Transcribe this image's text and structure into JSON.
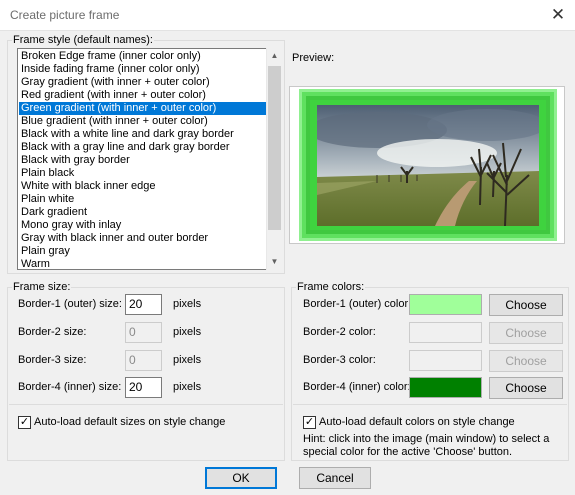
{
  "window": {
    "title": "Create picture frame",
    "close_glyph": "✕"
  },
  "frame_style": {
    "legend": "Frame style (default names):",
    "items": [
      "Broken Edge frame (inner color only)",
      "Inside fading frame (inner color only)",
      "Gray gradient (with inner + outer color)",
      "Red gradient (with inner + outer color)",
      "Green gradient (with inner + outer color)",
      "Blue gradient (with inner + outer color)",
      "Black with a white line and dark gray border",
      "Black with a gray line and dark gray border",
      "Black with gray border",
      "Plain black",
      "White with black inner edge",
      "Plain white",
      "Dark gradient",
      "Mono gray with inlay",
      "Gray with black inner and outer border",
      "Plain gray",
      "Warm"
    ],
    "selected": "Green gradient (with inner + outer color)"
  },
  "preview": {
    "label": "Preview:"
  },
  "frame_size": {
    "legend": "Frame size:",
    "rows": [
      {
        "label": "Border-1 (outer) size:",
        "value": "20",
        "unit": "pixels",
        "enabled": true
      },
      {
        "label": "Border-2 size:",
        "value": "0",
        "unit": "pixels",
        "enabled": false
      },
      {
        "label": "Border-3 size:",
        "value": "0",
        "unit": "pixels",
        "enabled": false
      },
      {
        "label": "Border-4 (inner) size:",
        "value": "20",
        "unit": "pixels",
        "enabled": true
      }
    ],
    "autoload_label": "Auto-load default sizes on style change",
    "autoload_checked": true
  },
  "frame_colors": {
    "legend": "Frame colors:",
    "rows": [
      {
        "label": "Border-1 (outer) color:",
        "color": "#a0ff9a",
        "button": "Choose",
        "enabled": true
      },
      {
        "label": "Border-2 color:",
        "color": "#f0f0f0",
        "button": "Choose",
        "enabled": false
      },
      {
        "label": "Border-3 color:",
        "color": "#f0f0f0",
        "button": "Choose",
        "enabled": false
      },
      {
        "label": "Border-4 (inner) color:",
        "color": "#008000",
        "button": "Choose",
        "enabled": true
      }
    ],
    "autoload_label": "Auto-load default colors on style change",
    "autoload_checked": true,
    "hint": "Hint: click into the image (main window) to select a special color for the active 'Choose' button."
  },
  "buttons": {
    "ok": "OK",
    "cancel": "Cancel"
  },
  "icons": {
    "scroll_up": "▲",
    "scroll_down": "▼",
    "check": "✓"
  }
}
